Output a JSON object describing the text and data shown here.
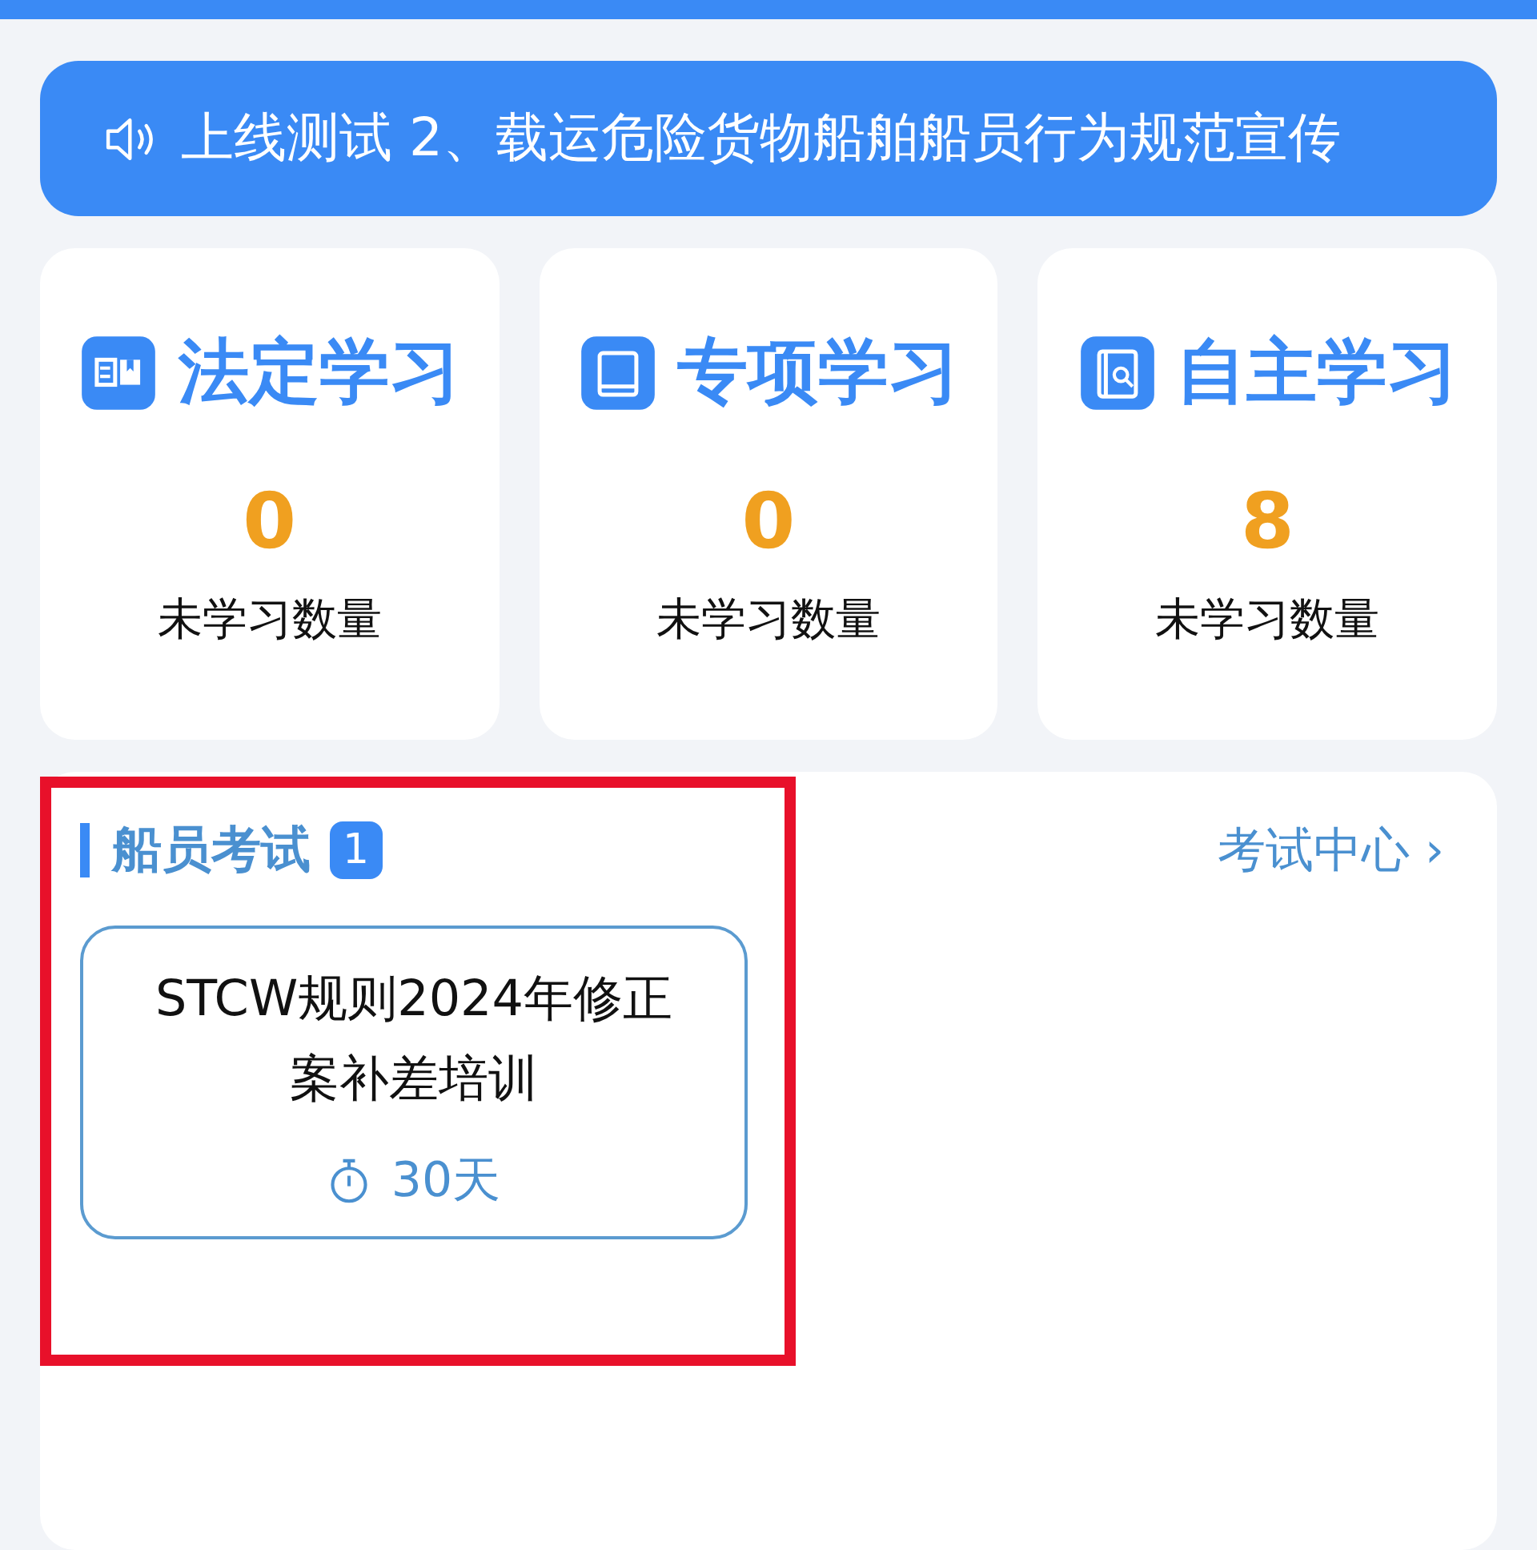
{
  "notice": {
    "text": "上线测试 2、载运危险货物船舶船员行为规范宣传"
  },
  "study_cards": [
    {
      "kind": "statutory",
      "title": "法定学习",
      "count": "0",
      "label": "未学习数量"
    },
    {
      "kind": "special",
      "title": "专项学习",
      "count": "0",
      "label": "未学习数量"
    },
    {
      "kind": "self",
      "title": "自主学习",
      "count": "8",
      "label": "未学习数量"
    }
  ],
  "exam_section": {
    "title": "船员考试",
    "badge": "1",
    "link": "考试中心",
    "link_arrow": "›",
    "highlighted": true,
    "exams": [
      {
        "title": "STCW规则2024年修正案补差培训",
        "duration": "30天"
      }
    ]
  }
}
